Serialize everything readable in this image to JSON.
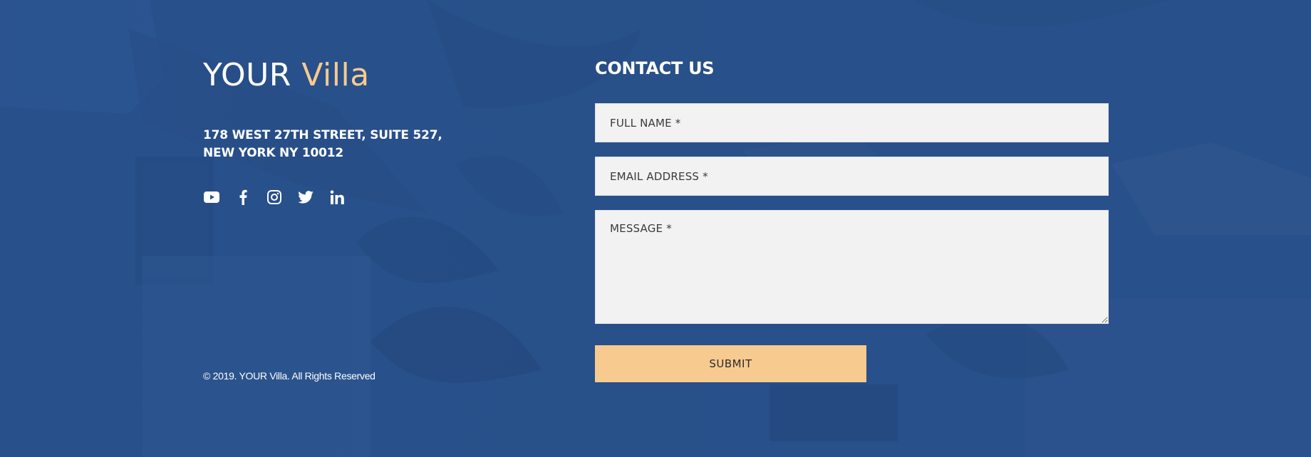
{
  "brand": {
    "word1": "YOUR",
    "word2": "Villa"
  },
  "contact": {
    "address_line1": "178 WEST 27TH STREET, SUITE 527,",
    "address_line2": "NEW YORK NY 10012"
  },
  "social": [
    "youtube-icon",
    "facebook-icon",
    "instagram-icon",
    "twitter-icon",
    "linkedin-icon"
  ],
  "copyright": "© 2019. YOUR Villa. All Rights Reserved",
  "form": {
    "title": "CONTACT US",
    "name_placeholder": "FULL NAME *",
    "email_placeholder": "EMAIL ADDRESS *",
    "message_placeholder": "MESSAGE *",
    "submit_label": "SUBMIT"
  },
  "colors": {
    "background": "#2a5590",
    "accent": "#f7ca8f",
    "field_background": "#f2f2f2",
    "text": "#ffffff"
  }
}
